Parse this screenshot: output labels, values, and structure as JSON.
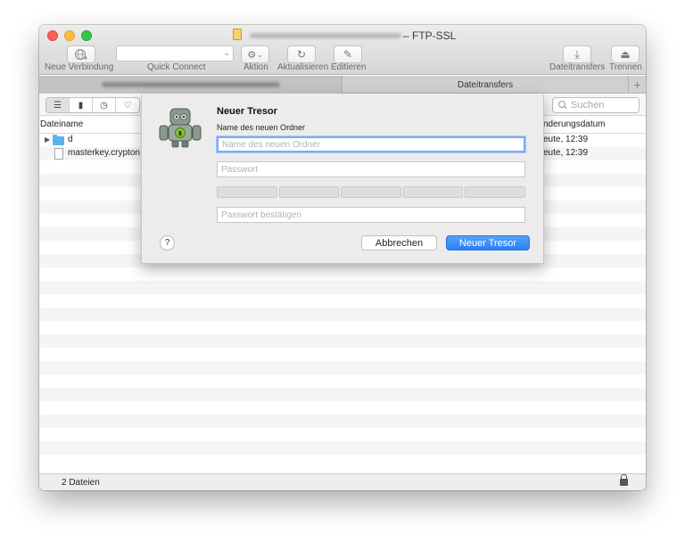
{
  "window": {
    "title": "– FTP-SSL"
  },
  "toolbar": {
    "new_connection_label": "Neue Verbindung",
    "quick_connect_label": "Quick Connect",
    "action_label": "Aktion",
    "refresh_label": "Aktualisieren",
    "edit_label": "Editieren",
    "transfers_label": "Dateitransfers",
    "disconnect_label": "Trennen"
  },
  "tabs": {
    "transfers": "Dateitransfers",
    "add": "+"
  },
  "search": {
    "placeholder": "Suchen"
  },
  "columns": {
    "filename": "Dateiname",
    "modified": "nderungsdatum"
  },
  "files": [
    {
      "name": "d",
      "type": "folder",
      "modified": "eute, 12:39"
    },
    {
      "name": "masterkey.crypton",
      "type": "file",
      "modified": "eute, 12:39"
    }
  ],
  "status": {
    "count": "2 Dateien"
  },
  "dialog": {
    "title": "Neuer Tresor",
    "label": "Name des neuen Ordner",
    "folder_placeholder": "Name des neuen Ordner",
    "password_placeholder": "Passwort",
    "confirm_placeholder": "Passwort bestätigen",
    "help": "?",
    "cancel": "Abbrechen",
    "submit": "Neuer Tresor",
    "strength_segments": 5
  },
  "colors": {
    "primary_button": "#2a7ff6",
    "focus_ring": "#7baaf7",
    "folder": "#5ab2ec",
    "close": "#fc605b",
    "minimize": "#fdbc40",
    "maximize": "#34c84a"
  }
}
